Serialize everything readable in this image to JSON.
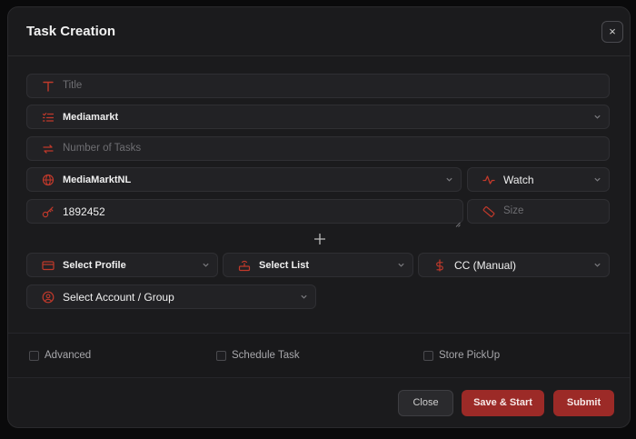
{
  "modal": {
    "title": "Task Creation",
    "close_icon_glyph": "×"
  },
  "fields": {
    "title_placeholder": "Title",
    "store_value": "Mediamarkt",
    "tasks_placeholder": "Number of Tasks",
    "region_value": "MediaMarktNL",
    "mode_value": "Watch",
    "product_value": "1892452",
    "size_placeholder": "Size",
    "profile_value": "Select Profile",
    "list_value": "Select List",
    "payment_value": "CC (Manual)",
    "account_value": "Select Account / Group"
  },
  "options": {
    "advanced": "Advanced",
    "schedule": "Schedule Task",
    "store_pickup": "Store PickUp"
  },
  "buttons": {
    "close": "Close",
    "save_start": "Save & Start",
    "submit": "Submit"
  },
  "colors": {
    "accent": "#c0392b",
    "button_red": "#9c2a27",
    "panel": "#1b1b1d",
    "field": "#222225"
  }
}
